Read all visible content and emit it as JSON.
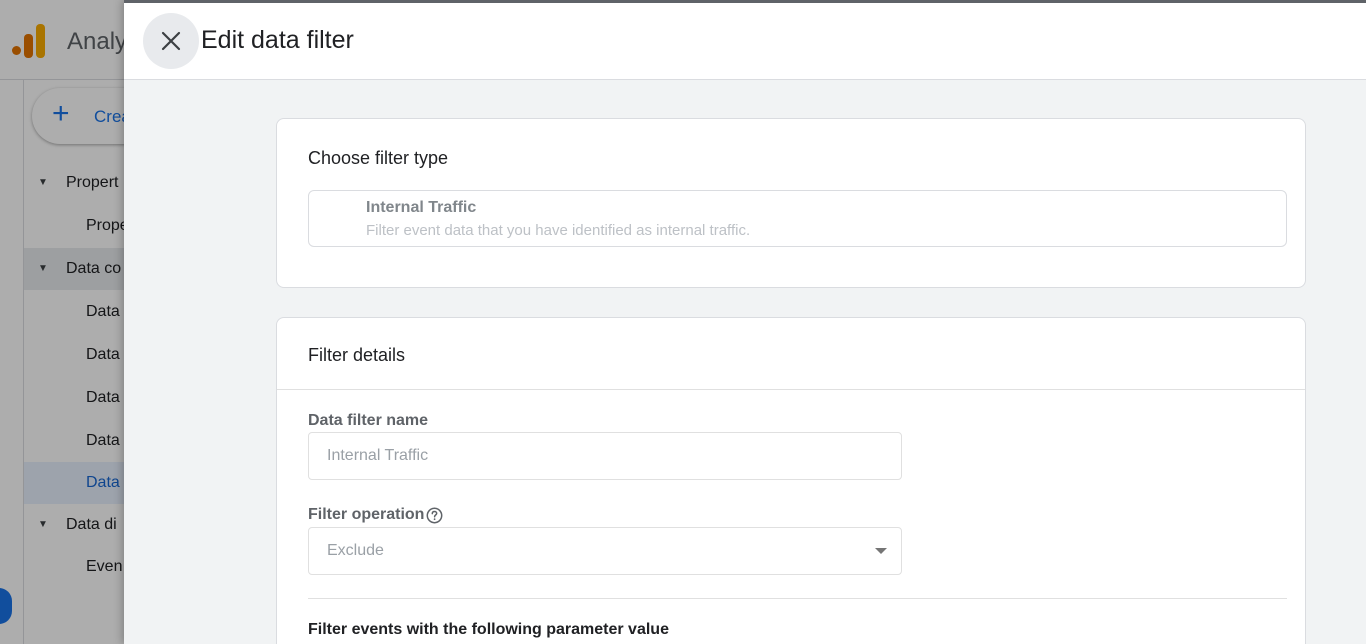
{
  "background": {
    "app_title": "Analy",
    "create_label": "Crea",
    "nav_items": [
      {
        "label": "Propert",
        "kind": "group",
        "expanded": true
      },
      {
        "label": "Prope",
        "kind": "sub"
      },
      {
        "label": "Data co",
        "kind": "group",
        "expanded": true
      },
      {
        "label": "Data",
        "kind": "sub"
      },
      {
        "label": "Data",
        "kind": "sub"
      },
      {
        "label": "Data",
        "kind": "sub"
      },
      {
        "label": "Data",
        "kind": "sub"
      },
      {
        "label": "Data",
        "kind": "sub",
        "active": true
      },
      {
        "label": "Data di",
        "kind": "group",
        "expanded": true
      },
      {
        "label": "Even",
        "kind": "sub"
      }
    ]
  },
  "panel": {
    "title": "Edit data filter",
    "close_icon": "close-icon"
  },
  "filter_type_card": {
    "title": "Choose filter type",
    "option_title": "Internal Traffic",
    "option_description": "Filter event data that you have identified as internal traffic."
  },
  "filter_details_card": {
    "title": "Filter details",
    "name_label": "Data filter name",
    "name_value": "Internal Traffic",
    "operation_label": "Filter operation",
    "operation_value": "Exclude",
    "parameter_section_label": "Filter events with the following parameter value"
  },
  "colors": {
    "accent": "#1a73e8",
    "logo_orange": "#e37400",
    "logo_yellow": "#f9ab00"
  }
}
